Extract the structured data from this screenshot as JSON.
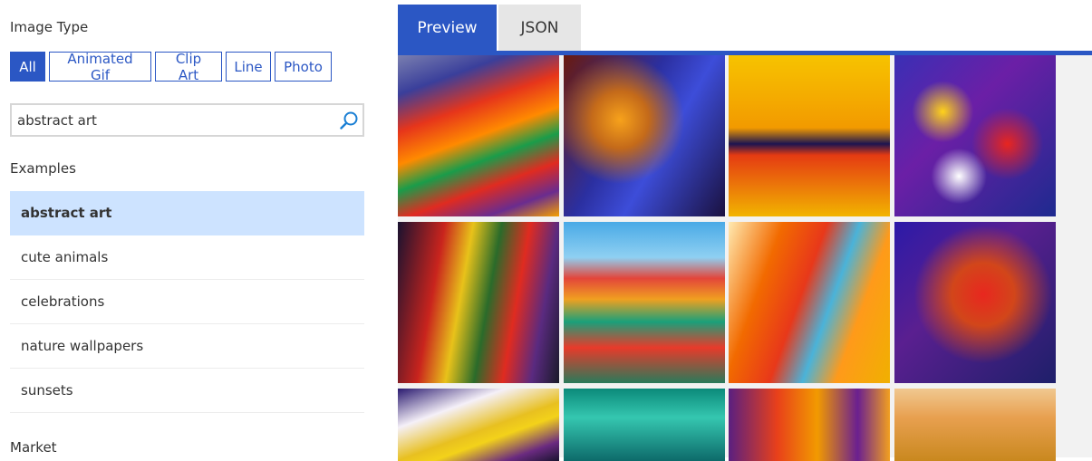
{
  "sidebar": {
    "image_type_label": "Image Type",
    "filters": [
      {
        "label": "All",
        "active": true
      },
      {
        "label": "Animated Gif",
        "active": false
      },
      {
        "label": "Clip Art",
        "active": false
      },
      {
        "label": "Line",
        "active": false
      },
      {
        "label": "Photo",
        "active": false
      }
    ],
    "search": {
      "value": "abstract art",
      "icon": "search-icon"
    },
    "examples_label": "Examples",
    "examples": [
      {
        "label": "abstract art",
        "active": true
      },
      {
        "label": "cute animals",
        "active": false
      },
      {
        "label": "celebrations",
        "active": false
      },
      {
        "label": "nature wallpapers",
        "active": false
      },
      {
        "label": "sunsets",
        "active": false
      }
    ],
    "market_label": "Market"
  },
  "tabs": [
    {
      "label": "Preview",
      "active": true
    },
    {
      "label": "JSON",
      "active": false
    }
  ],
  "colors": {
    "accent": "#2b57c4",
    "selected_example_bg": "#cde3ff"
  }
}
